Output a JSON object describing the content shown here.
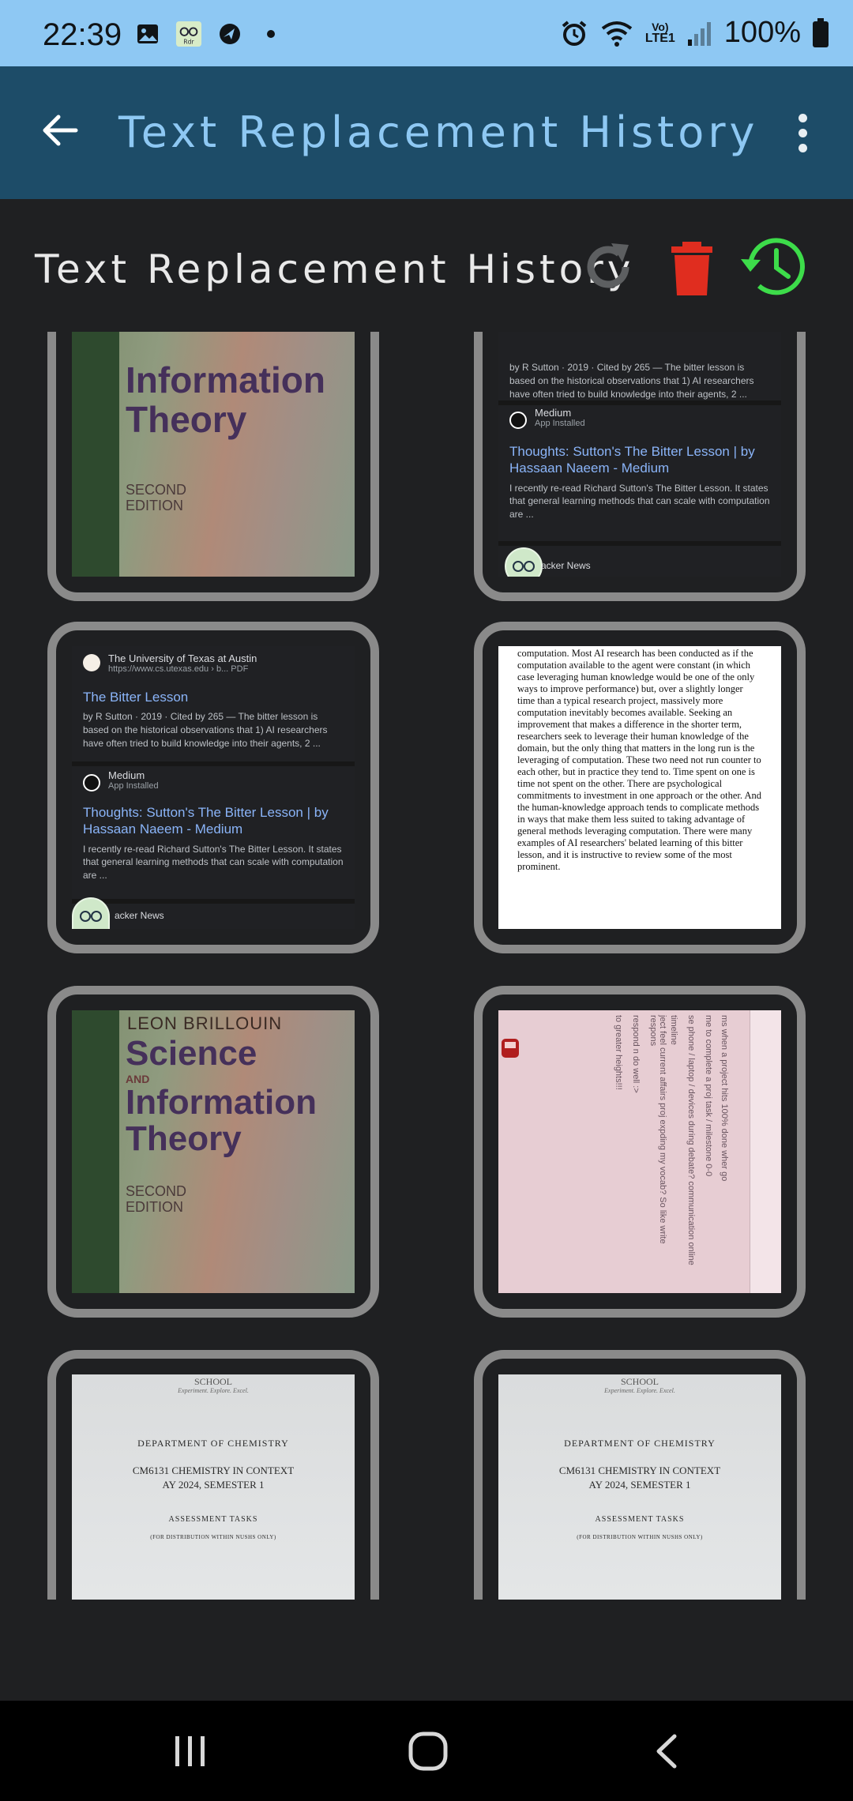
{
  "status_bar": {
    "time": "22:39",
    "battery": "100%",
    "network": "LTE1",
    "network_label": "Vo)",
    "left_icons": [
      "image-icon",
      "app-notification-icon",
      "navigation-icon",
      "dot-icon"
    ],
    "right_icons": [
      "alarm-icon",
      "wifi-icon",
      "lte-icon",
      "signal-icon",
      "battery-icon"
    ]
  },
  "app_bar": {
    "title": "Text Replacement History"
  },
  "section": {
    "title": "Text Replacement History",
    "colors": {
      "refresh": "#5d5f61",
      "delete": "#e02d1f",
      "history": "#3ddc4a"
    }
  },
  "cards": [
    {
      "type": "book",
      "title_lines": [
        "Information",
        "Theory"
      ],
      "edition_lines": [
        "SECOND",
        "EDITION"
      ]
    },
    {
      "type": "search",
      "snippet_top": "by R Sutton · 2019 · Cited by 265 — The bitter lesson is based on the historical observations that 1) AI researchers have often tried to build knowledge into their agents, 2 ...",
      "source": "Medium",
      "source_sub": "App Installed",
      "title": "Thoughts: Sutton's The Bitter Lesson | by Hassaan Naeem - Medium",
      "snippet": "I recently re-read Richard Sutton's The Bitter Lesson. It states that general learning methods that can scale with computation are ...",
      "next": "acker News"
    },
    {
      "type": "search",
      "source_top": "The University of Texas at Austin",
      "url_top": "https://www.cs.utexas.edu › b... PDF",
      "title_top": "The Bitter Lesson",
      "snippet_top": "by R Sutton · 2019 · Cited by 265 — The bitter lesson is based on the historical observations that 1) AI researchers have often tried to build knowledge into their agents, 2 ...",
      "source": "Medium",
      "source_sub": "App Installed",
      "title": "Thoughts: Sutton's The Bitter Lesson | by Hassaan Naeem - Medium",
      "snippet": "I recently re-read Richard Sutton's The Bitter Lesson. It states that general learning methods that can scale with computation are ...",
      "next": "acker News"
    },
    {
      "type": "paper",
      "text": "computation. Most AI research has been conducted as if the computation available to the agent were constant (in which case leveraging human knowledge would be one of the only ways to improve performance) but, over a slightly longer time than a typical research project, massively more computation inevitably becomes available. Seeking an improvement that makes a difference in the shorter term, researchers seek to leverage their human knowledge of the domain, but the only thing that matters in the long run is the leveraging of computation. These two need not run counter to each other, but in practice they tend to. Time spent on one is time not spent on the other. There are psychological commitments to investment in one approach or the other. And the human-knowledge approach tends to complicate methods in ways that make them less suited to taking advantage of general methods leveraging computation. There were many examples of AI researchers' belated learning of this bitter lesson, and it is instructive to review some of the most prominent."
    },
    {
      "type": "book",
      "author": "LEON BRILLOUIN",
      "title_lines": [
        "Science",
        "AND",
        "Information",
        "Theory"
      ],
      "edition_lines": [
        "SECOND",
        "EDITION"
      ]
    },
    {
      "type": "handwriting",
      "lines": [
        "ms when a project hits 100% done wher go",
        "me to complete a proj task / milestone 0-0",
        "se phone / laptop / devices during debate? communication online",
        "timeline",
        "ject feel current affairs proj expding my vocab? So like write respons",
        "respond n do well :>",
        "to greater heights!!!"
      ]
    },
    {
      "type": "doc",
      "school": "SCHOOL",
      "tagline": "Experiment. Explore. Excel.",
      "dept": "DEPARTMENT OF CHEMISTRY",
      "course": "CM6131 CHEMISTRY IN CONTEXT",
      "ay": "AY 2024, SEMESTER 1",
      "assess": "ASSESSMENT TASKS",
      "dist": "(FOR DISTRIBUTION WITHIN NUSHS ONLY)"
    },
    {
      "type": "doc",
      "school": "SCHOOL",
      "tagline": "Experiment. Explore. Excel.",
      "dept": "DEPARTMENT OF CHEMISTRY",
      "course": "CM6131 CHEMISTRY IN CONTEXT",
      "ay": "AY 2024, SEMESTER 1",
      "assess": "ASSESSMENT TASKS",
      "dist": "(FOR DISTRIBUTION WITHIN NUSHS ONLY)"
    }
  ],
  "nav_bar": {
    "buttons": [
      "recent-apps-button",
      "home-button",
      "back-button"
    ]
  }
}
